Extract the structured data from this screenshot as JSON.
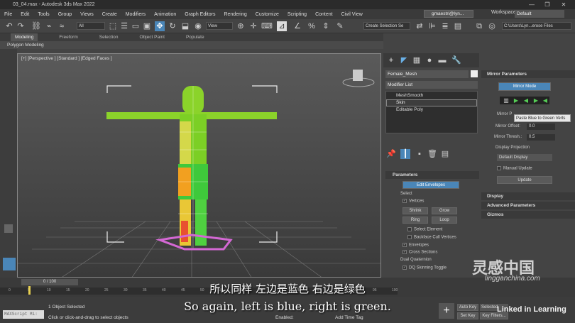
{
  "window": {
    "title": "03_04.max - Autodesk 3ds Max 2022",
    "minimize": "—",
    "restore": "❐",
    "close": "✕"
  },
  "menu": [
    "File",
    "Edit",
    "Tools",
    "Group",
    "Views",
    "Create",
    "Modifiers",
    "Animation",
    "Graph Editors",
    "Rendering",
    "Customize",
    "Scripting",
    "Content",
    "Civil View"
  ],
  "user": {
    "name": "gmaestri@lyn...",
    "workspaces_label": "Workspaces:",
    "workspace": "Default"
  },
  "toolbar": {
    "filter": "All",
    "view": "View",
    "selection_set": "Create Selection Se",
    "path": "C:\\Users\\Lyn...erose Files"
  },
  "ribbon": {
    "tabs": [
      "Modeling",
      "Freeform",
      "Selection",
      "Object Paint",
      "Populate"
    ],
    "active": "Modeling",
    "sub": "Polygon Modeling"
  },
  "viewport": {
    "label": "[+] [Perspective ] [Standard ] [Edged Faces ]"
  },
  "command_panel": {
    "object_name": "Female_Mesh",
    "modifier_list": "Modifier List",
    "stack": [
      "MeshSmooth",
      "Skin",
      "Editable Poly"
    ],
    "parameters": {
      "title": "Parameters",
      "edit_envelopes": "Edit Envelopes",
      "select_label": "Select",
      "vertices": "Vertices",
      "shrink": "Shrink",
      "grow": "Grow",
      "ring": "Ring",
      "loop": "Loop",
      "select_element": "Select Element",
      "backface": "Backface Cull Vertices",
      "envelopes": "Envelopes",
      "cross_sections": "Cross Sections",
      "dual_quaternion": "Dual Quaternion",
      "dq_toggle": "DQ Skinning Toggle"
    }
  },
  "mirror": {
    "title": "Mirror Parameters",
    "mode_btn": "Mirror Mode",
    "mirror_label": "Mirror P",
    "tooltip": "Paste Blue to Green Verts",
    "offset_label": "Mirror Offset:",
    "offset_value": "0.0",
    "thresh_label": "Mirror Thresh.:",
    "thresh_value": "0.5",
    "display_projection": "Display Projection",
    "display_default": "Default Display",
    "manual_update": "Manual Update",
    "update": "Update"
  },
  "rollouts": [
    "Display",
    "Advanced Parameters",
    "Gizmos"
  ],
  "timeline": {
    "frame": "0 / 100",
    "ticks": [
      "0",
      "5",
      "10",
      "15",
      "20",
      "25",
      "30",
      "35",
      "40",
      "45",
      "50",
      "55",
      "60",
      "65",
      "70",
      "75",
      "80",
      "85",
      "90",
      "95",
      "100"
    ]
  },
  "status": {
    "maxscript": "MAXScript Mi:",
    "selected": "1 Object Selected",
    "hint": "Click or click-and-drag to select objects",
    "enabled": "Enabled:",
    "add_time_tag": "Add Time Tag",
    "auto_key": "Auto Key",
    "set_key": "Set Key",
    "selected_label": "Selected",
    "key_filters": "Key Filters..."
  },
  "subtitles": {
    "cn": "所以同样 左边是蓝色 右边是绿色",
    "en": "So again, left is blue, right is green."
  },
  "watermark": {
    "cn": "灵感中国",
    "en": "lingganchina.com",
    "linkedin": "Linked in Learning"
  },
  "colors": {
    "accent": "#4a86b8",
    "envelope": "#d468d4"
  }
}
